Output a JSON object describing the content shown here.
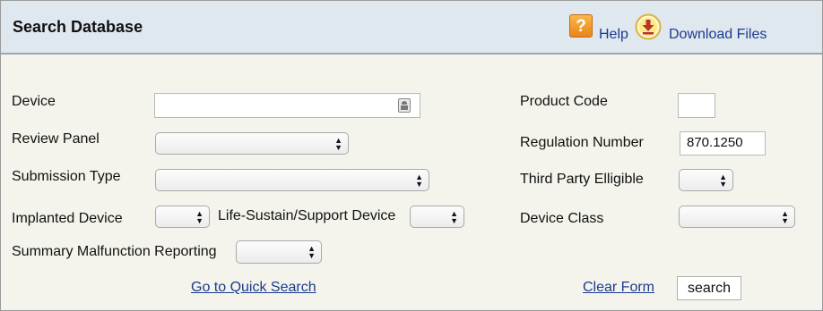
{
  "header": {
    "title": "Search Database",
    "help_label": "Help",
    "help_icon_glyph": "?",
    "download_label": "Download Files"
  },
  "form": {
    "device": {
      "label": "Device",
      "value": ""
    },
    "review_panel": {
      "label": "Review Panel",
      "selected": ""
    },
    "submission_type": {
      "label": "Submission Type",
      "selected": ""
    },
    "implanted_device": {
      "label": "Implanted Device",
      "selected": ""
    },
    "life_sustain": {
      "label": "Life-Sustain/Support Device",
      "selected": ""
    },
    "summary_malfunction": {
      "label": "Summary Malfunction Reporting",
      "selected": ""
    },
    "product_code": {
      "label": "Product Code",
      "value": ""
    },
    "regulation_number": {
      "label": "Regulation Number",
      "value": "870.1250"
    },
    "third_party": {
      "label": "Third Party Elligible",
      "selected": ""
    },
    "device_class": {
      "label": "Device Class",
      "selected": ""
    }
  },
  "footer": {
    "quick_search": "Go to Quick Search",
    "clear_form": "Clear Form",
    "search": "search"
  },
  "icons": {
    "help": "help-icon",
    "download": "download-icon",
    "picker": "contact-picker-icon",
    "select_arrow": "up-down-arrow-icon"
  },
  "colors": {
    "header_bg": "#dfe7ef",
    "panel_bg": "#f4f4ec",
    "link": "#1a3b8f",
    "help_icon": "#f29a2e",
    "download_icon": "#c0392b"
  }
}
